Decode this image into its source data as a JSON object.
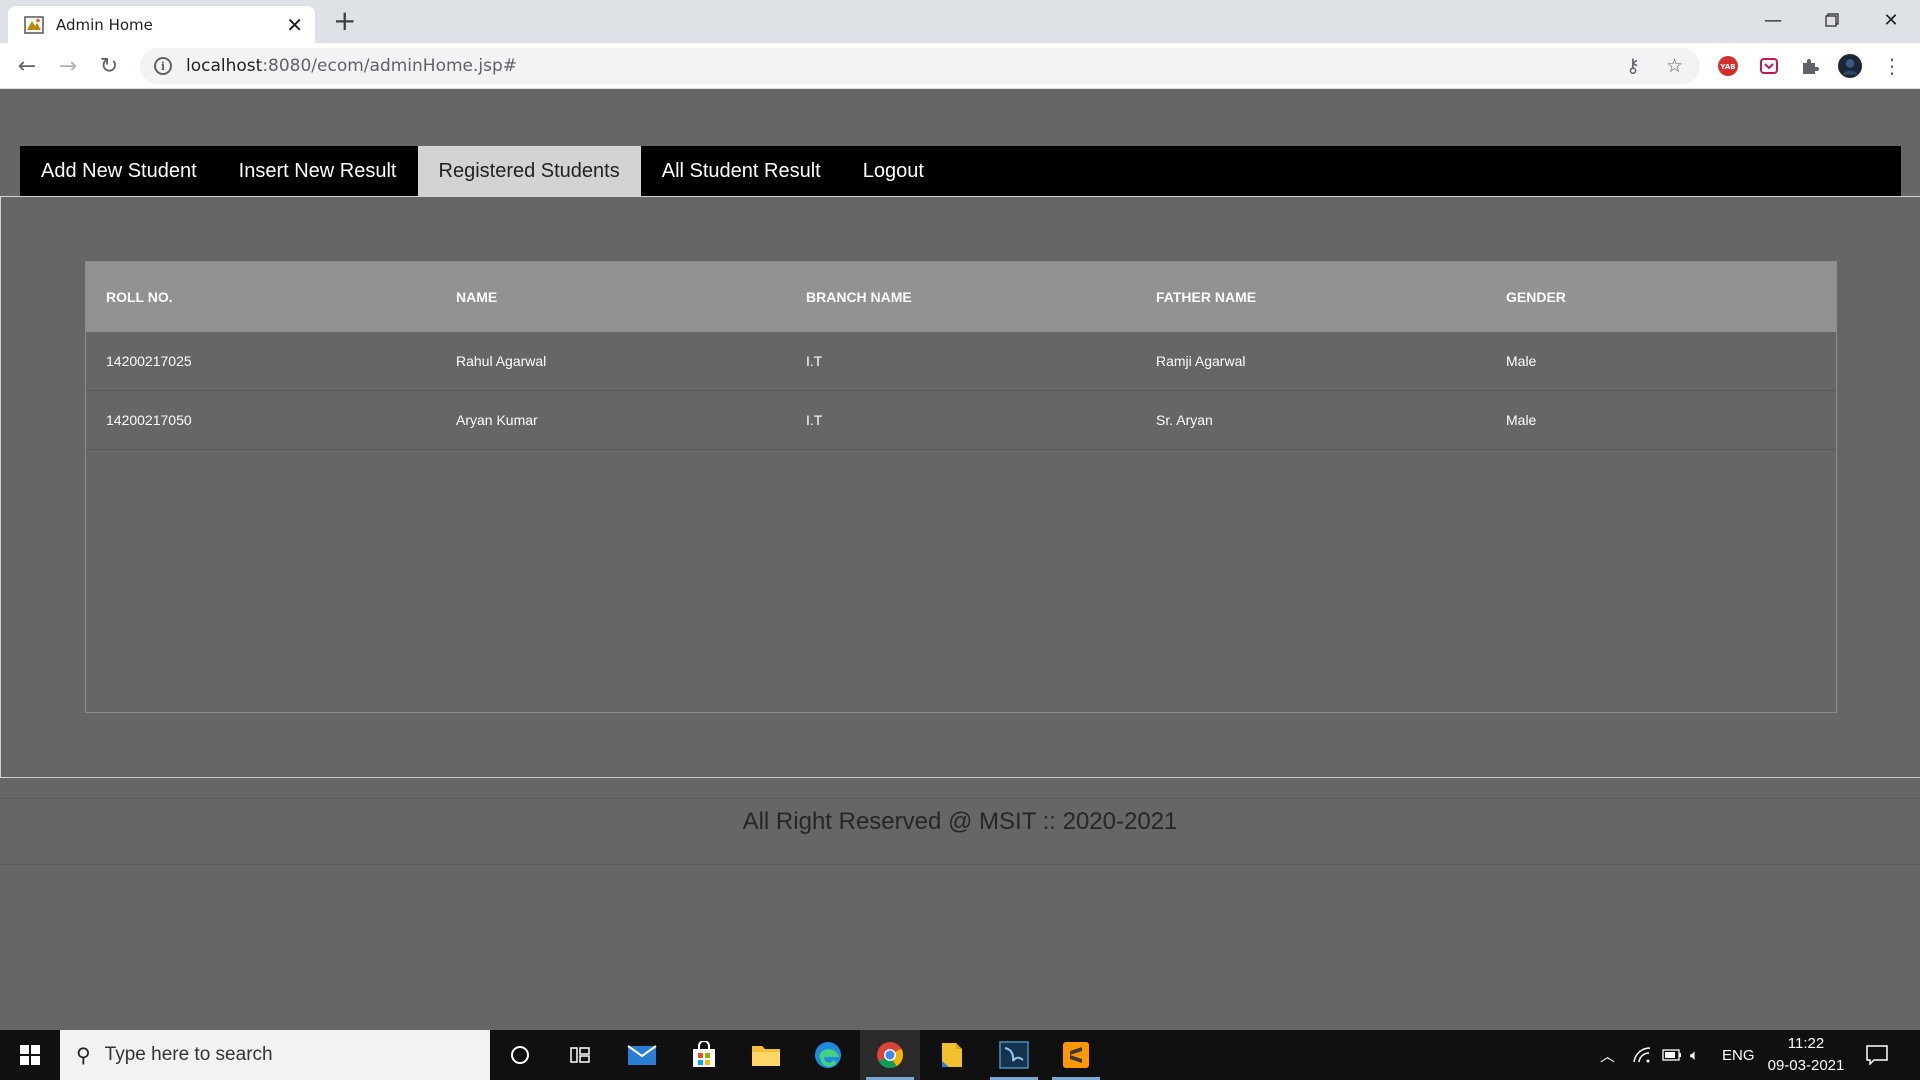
{
  "browser": {
    "tab_title": "Admin Home",
    "url_host": "localhost",
    "url_rest": ":8080/ecom/adminHome.jsp#",
    "extensions": [
      "key-icon",
      "star-icon",
      "yab-extension-icon",
      "pocket-extension-icon",
      "puzzle-icon",
      "avatar",
      "kebab-menu-icon"
    ]
  },
  "nav": {
    "items": [
      {
        "label": "Add New Student"
      },
      {
        "label": "Insert New Result"
      },
      {
        "label": "Registered Students"
      },
      {
        "label": "All Student Result"
      },
      {
        "label": "Logout"
      }
    ],
    "active_index": 2
  },
  "table": {
    "headers": [
      "ROLL NO.",
      "NAME",
      "BRANCH NAME",
      "FATHER NAME",
      "GENDER"
    ],
    "rows": [
      [
        "14200217025",
        "Rahul Agarwal",
        "I.T",
        "Ramji Agarwal",
        "Male"
      ],
      [
        "14200217050",
        "Aryan Kumar",
        "I.T",
        "Sr. Aryan",
        "Male"
      ]
    ]
  },
  "footer": {
    "text": "All Right Reserved @ MSIT :: 2020-2021"
  },
  "taskbar": {
    "search_placeholder": "Type here to search",
    "language": "ENG",
    "time": "11:22",
    "date": "09-03-2021"
  },
  "colors": {
    "page_bg": "#666666",
    "menubar_bg": "#000000",
    "menu_active_bg": "#d3d3d3",
    "table_header_bg": "#929292"
  }
}
